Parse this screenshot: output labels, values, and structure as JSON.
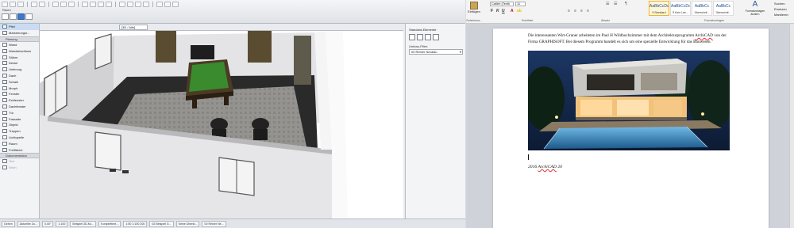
{
  "archicad": {
    "toolbar": {
      "layer_label": "Raum",
      "view_tab": "[3D / Alle]"
    },
    "toolbox": {
      "top_items": [
        {
          "label": "Pfeil",
          "selected": true,
          "disabled": false
        },
        {
          "label": "Markierungsr...",
          "selected": false,
          "disabled": false
        }
      ],
      "section_planung": "Planung",
      "planung_items": [
        {
          "label": "Wand",
          "selected": false,
          "disabled": false
        },
        {
          "label": "Wandabschluss",
          "selected": false,
          "disabled": false
        },
        {
          "label": "Stütze",
          "selected": false,
          "disabled": false
        },
        {
          "label": "Decke",
          "selected": false,
          "disabled": false
        },
        {
          "label": "Unterzug",
          "selected": false,
          "disabled": false
        },
        {
          "label": "Dach",
          "selected": false,
          "disabled": false
        },
        {
          "label": "Schale",
          "selected": false,
          "disabled": false
        },
        {
          "label": "Morph",
          "selected": false,
          "disabled": false
        },
        {
          "label": "Fenster",
          "selected": false,
          "disabled": false
        },
        {
          "label": "Eckfenster",
          "selected": false,
          "disabled": false
        },
        {
          "label": "Dachfenster",
          "selected": false,
          "disabled": false
        },
        {
          "label": "Tür",
          "selected": false,
          "disabled": false
        },
        {
          "label": "Fassade",
          "selected": false,
          "disabled": false
        },
        {
          "label": "Objekt",
          "selected": false,
          "disabled": false
        },
        {
          "label": "Treppen",
          "selected": false,
          "disabled": false
        },
        {
          "label": "Lichtquelle",
          "selected": false,
          "disabled": false
        },
        {
          "label": "Raum",
          "selected": false,
          "disabled": false
        },
        {
          "label": "Freifläche",
          "selected": false,
          "disabled": false
        }
      ],
      "section_doku": "Dokumentation",
      "doku_items": [
        {
          "label": "Text",
          "selected": false,
          "disabled": true
        },
        {
          "label": "Stroh",
          "selected": false,
          "disabled": true
        }
      ]
    },
    "panel": {
      "title": "Standard-Elemente",
      "filter_label": "Umbau-Filter:",
      "filter_value": "00 Reiner Neubau"
    },
    "statusbar": {
      "cells": [
        "Gehen",
        "Aktueller Zo...",
        "0,00°",
        "1:100",
        "Beispiel 3D-Ko...",
        "Komplettme...",
        "1:50 1:100 200",
        "02 Beispiel G...",
        "Keine Überst...",
        "00 Reiner Ne..."
      ]
    }
  },
  "word": {
    "ribbon": {
      "paste_label": "Einfügen",
      "font_name": "Calibri (Textk",
      "font_size": "11",
      "format_buttons": [
        "F",
        "K",
        "U"
      ],
      "group_labels": {
        "clipboard": "Zwischena...",
        "font": "Schriftart",
        "paragraph": "Absatz",
        "styles": "Formatvorlagen"
      },
      "styles": [
        {
          "sample": "AaBbCcDc",
          "name": "¶ Standard",
          "selected": true
        },
        {
          "sample": "AaBbCcDc",
          "name": "¶ Kein Lee...",
          "selected": false
        },
        {
          "sample": "AaBbCc",
          "name": "Überschrif...",
          "selected": false
        },
        {
          "sample": "AaBbCc",
          "name": "Überschrif...",
          "selected": false
        }
      ],
      "styles_button": "Formatvorlagen ändern",
      "edit": [
        "Suchen",
        "Ersetzen",
        "Markieren"
      ]
    },
    "document": {
      "para_line1": "Die interessanten Wirt-Gruner arbeiteten im Paul H Wildhuchzimmer mit dem Architekturprogramm",
      "para_archicad": "ArchiCAD",
      "para_line2": " von der Firma GRAPHISOFT. Bei diesem Programm handelt es sich um eine spezielle Entwicklung für das Bauwesen.",
      "caption_prefix": "2016 ",
      "caption_archicad": "ArchiCAD",
      "caption_suffix": " 20"
    }
  },
  "colors": {
    "accent": "#3d78c9",
    "word_blue": "#2b579a",
    "selection": "#c9dcf3"
  }
}
